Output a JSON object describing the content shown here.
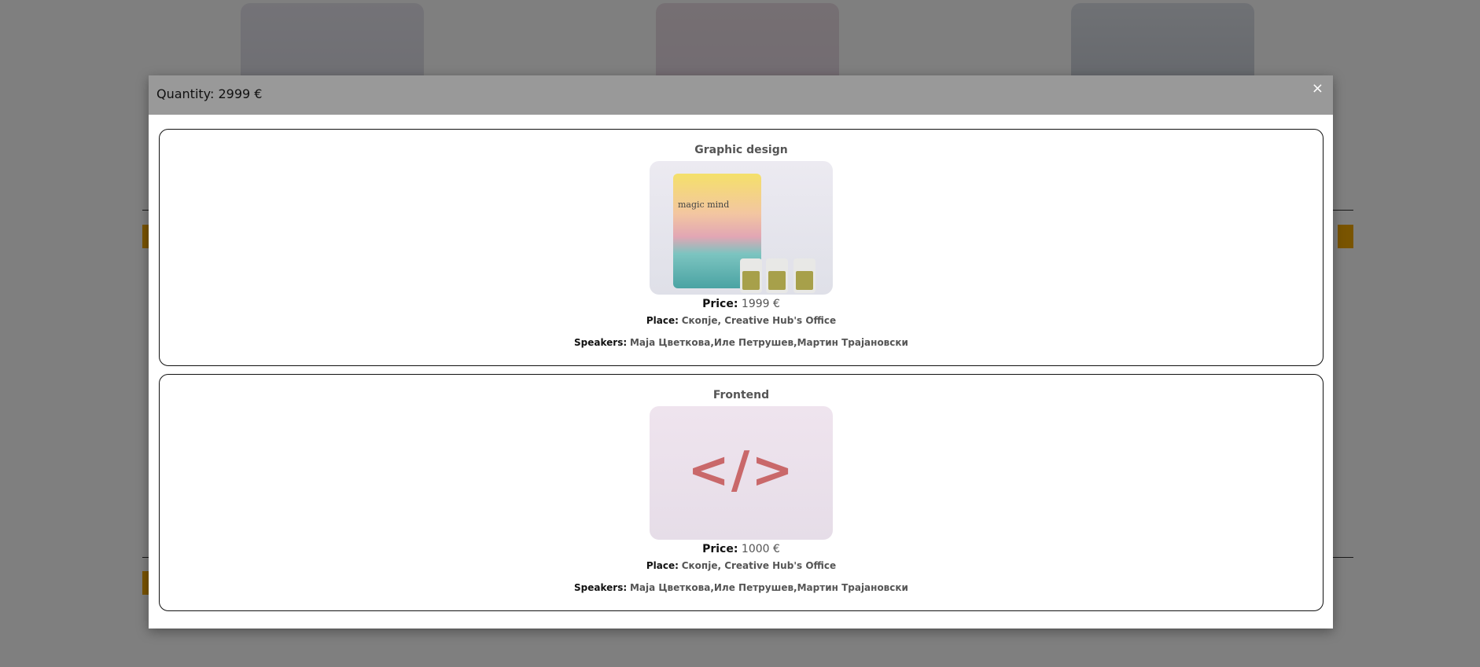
{
  "modal": {
    "title": "Quantity: 2999 €",
    "close_label": "×"
  },
  "items": [
    {
      "name": "Graphic design",
      "image_label": "magic mind",
      "price_label": "Price:",
      "price": "1999 €",
      "place_label": "Place:",
      "place": "Скопје, Creative Hub's Office",
      "speakers_label": "Speakers:",
      "speakers": "Маја Цветкова,Иле Петрушев,Мартин Трајановски"
    },
    {
      "name": "Frontend",
      "image_label": "</>",
      "price_label": "Price:",
      "price": "1000 €",
      "place_label": "Place:",
      "place": "Скопје, Creative Hub's Office",
      "speakers_label": "Speakers:",
      "speakers": "Маја Цветкова,Иле Петрушев,Мартин Трајановски"
    }
  ],
  "colors": {
    "overlay": "#7f7f7f",
    "modal_header": "#999999",
    "accent": "#f2a900"
  }
}
